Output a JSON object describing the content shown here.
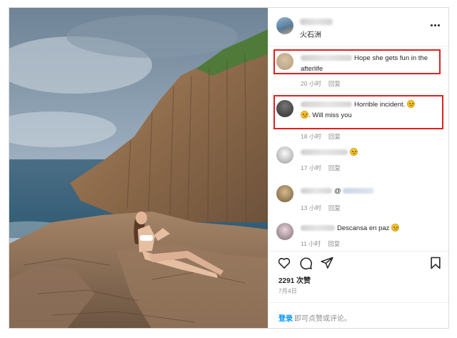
{
  "post": {
    "location": "火石洲",
    "likes": "2291 次赞",
    "date": "7月4日"
  },
  "comments": [
    {
      "text": "Hope she gets fun in the afterlife",
      "time": "20 小时",
      "reply": "回复",
      "highlighted": true
    },
    {
      "text_before": "Horrible incident. ",
      "text_after": ". Will miss you",
      "time": "18 小时",
      "reply": "回复",
      "highlighted": true
    },
    {
      "text": "",
      "time": "17 小时",
      "reply": "回复",
      "highlighted": false
    },
    {
      "text": "@",
      "time": "13 小时",
      "reply": "回复",
      "highlighted": false
    },
    {
      "text": "Descansa en paz ",
      "time": "11 小时",
      "reply": "回复",
      "highlighted": false
    }
  ],
  "footer": {
    "login_link": "登录",
    "login_text": "即可点赞或评论。"
  },
  "icons": {
    "more": "more-options-icon",
    "like": "heart-icon",
    "comment": "comment-icon",
    "share": "send-icon",
    "save": "bookmark-icon",
    "emoji": "sad-face-emoji"
  },
  "colors": {
    "highlight": "#e02020",
    "link": "#0095f6",
    "meta": "#8e8e8e"
  }
}
